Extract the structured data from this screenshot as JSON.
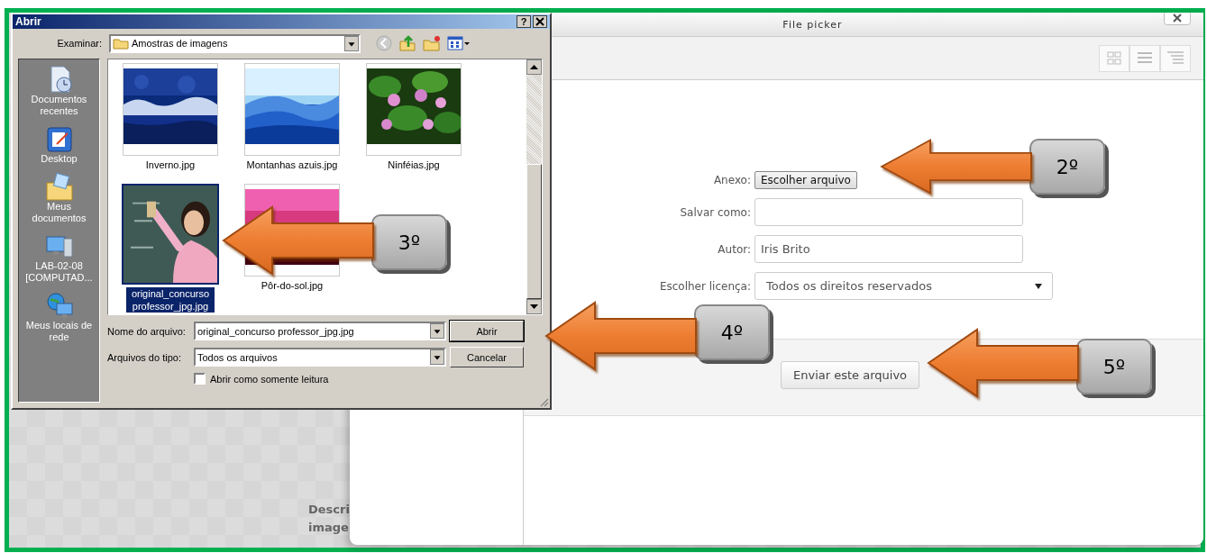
{
  "background": {
    "texts": [
      "Descri",
      "image"
    ]
  },
  "file_picker": {
    "title": "File picker",
    "fields": [
      {
        "kind": "file",
        "label": "Anexo:",
        "button": "Escolher arquivo"
      },
      {
        "kind": "text",
        "label": "Salvar como:"
      },
      {
        "kind": "text",
        "label": "Autor:",
        "value": "Iris Brito"
      },
      {
        "kind": "select",
        "label": "Escolher licença:",
        "value": "Todos os direitos reservados"
      }
    ],
    "submit": "Enviar este arquivo"
  },
  "open_dialog": {
    "title": "Abrir",
    "help": "?",
    "look_in": {
      "label": "Examinar:",
      "value": "Amostras de imagens"
    },
    "places": [
      {
        "kind": "recent",
        "label": "Documentos recentes"
      },
      {
        "kind": "desktop",
        "label": "Desktop"
      },
      {
        "kind": "documents",
        "label": "Meus documentos"
      },
      {
        "kind": "computer",
        "label": "LAB-02-08 [COMPUTAD..."
      },
      {
        "kind": "network",
        "label": "Meus locais de rede"
      }
    ],
    "files": [
      {
        "name": "Inverno.jpg",
        "selected": false
      },
      {
        "name": "Montanhas azuis.jpg",
        "selected": false
      },
      {
        "name": "Ninféias.jpg",
        "selected": false
      },
      {
        "name": "original_concurso professor_jpg.jpg",
        "selected": true
      },
      {
        "name": "Pôr-do-sol.jpg",
        "selected": false
      }
    ],
    "file_name": {
      "label": "Nome do arquivo:",
      "value": "original_concurso professor_jpg.jpg"
    },
    "file_type": {
      "label": "Arquivos do tipo:",
      "value": "Todos os arquivos"
    },
    "read_only": {
      "label": "Abrir como somente leitura",
      "checked": false
    },
    "buttons": [
      "Abrir",
      "Cancelar"
    ]
  },
  "annotations": [
    {
      "label": "2º"
    },
    {
      "label": "3º"
    },
    {
      "label": "4º"
    },
    {
      "label": "5º"
    }
  ]
}
